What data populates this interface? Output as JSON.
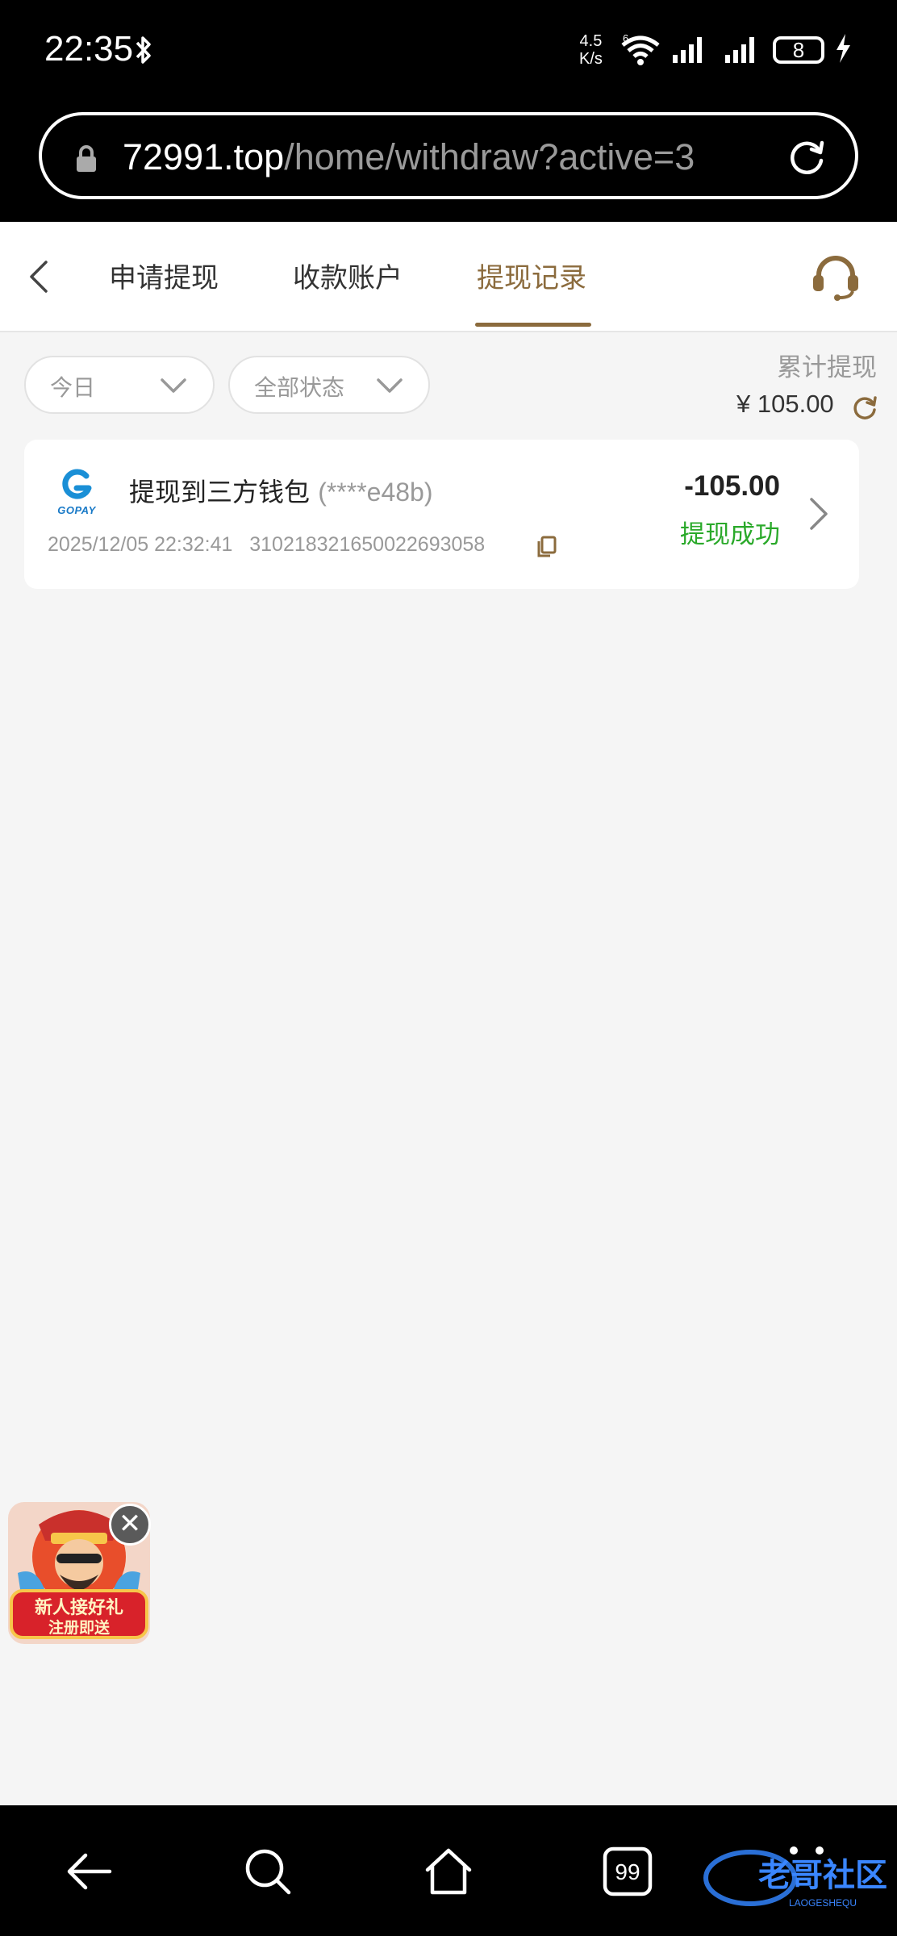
{
  "status_bar": {
    "time": "22:35",
    "net_speed_value": "4.5",
    "net_speed_unit": "K/s",
    "wifi_badge": "6",
    "battery": "8"
  },
  "browser": {
    "url_domain": "72991.top",
    "url_path": "/home/withdraw?active=3"
  },
  "header": {
    "tabs": [
      {
        "label": "申请提现",
        "active": false
      },
      {
        "label": "收款账户",
        "active": false
      },
      {
        "label": "提现记录",
        "active": true
      }
    ],
    "accent_color": "#8b6b3d"
  },
  "filters": {
    "date": "今日",
    "status": "全部状态"
  },
  "summary": {
    "label": "累计提现",
    "amount": "¥ 105.00"
  },
  "records": [
    {
      "wallet_logo": "GOPAY",
      "title": "提现到三方钱包",
      "account": "(****e48b)",
      "datetime": "2025/12/05 22:32:41",
      "order_no": "310218321650022693058",
      "amount": "-105.00",
      "status": "提现成功",
      "status_color": "#2aa92a"
    }
  ],
  "promo": {
    "line1": "新人接好礼",
    "line2": "注册即送"
  },
  "watermark": {
    "text": "老哥社区",
    "sub": "LAOGESHEQU"
  },
  "nav": {
    "tabs_count": "99"
  }
}
